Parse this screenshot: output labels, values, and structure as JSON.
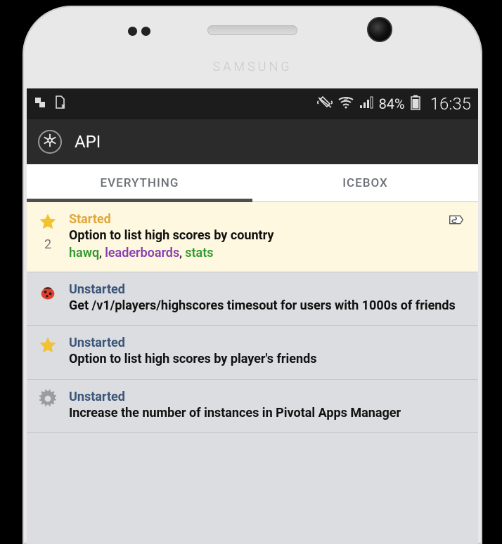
{
  "statusbar": {
    "battery_pct": "84%",
    "clock": "16:35"
  },
  "brand": "SAMSUNG",
  "app": {
    "title": "API"
  },
  "tabs": {
    "everything": "EVERYTHING",
    "icebox": "ICEBOX",
    "active": "everything"
  },
  "stories": [
    {
      "type": "feature",
      "points": "2",
      "status": "Started",
      "title": "Option to list high scores by country",
      "labels": [
        {
          "text": "hawq",
          "color": "green"
        },
        {
          "text": "leaderboards",
          "color": "purple"
        },
        {
          "text": "stats",
          "color": "green"
        }
      ],
      "has_attachment": true,
      "highlighted": true
    },
    {
      "type": "bug",
      "status": "Unstarted",
      "title": "Get /v1/players/highscores timesout for users with 1000s of friends"
    },
    {
      "type": "feature",
      "status": "Unstarted",
      "title": "Option to list high scores by player's friends"
    },
    {
      "type": "chore",
      "status": "Unstarted",
      "title": "Increase the number of instances in Pivotal Apps Manager"
    }
  ]
}
